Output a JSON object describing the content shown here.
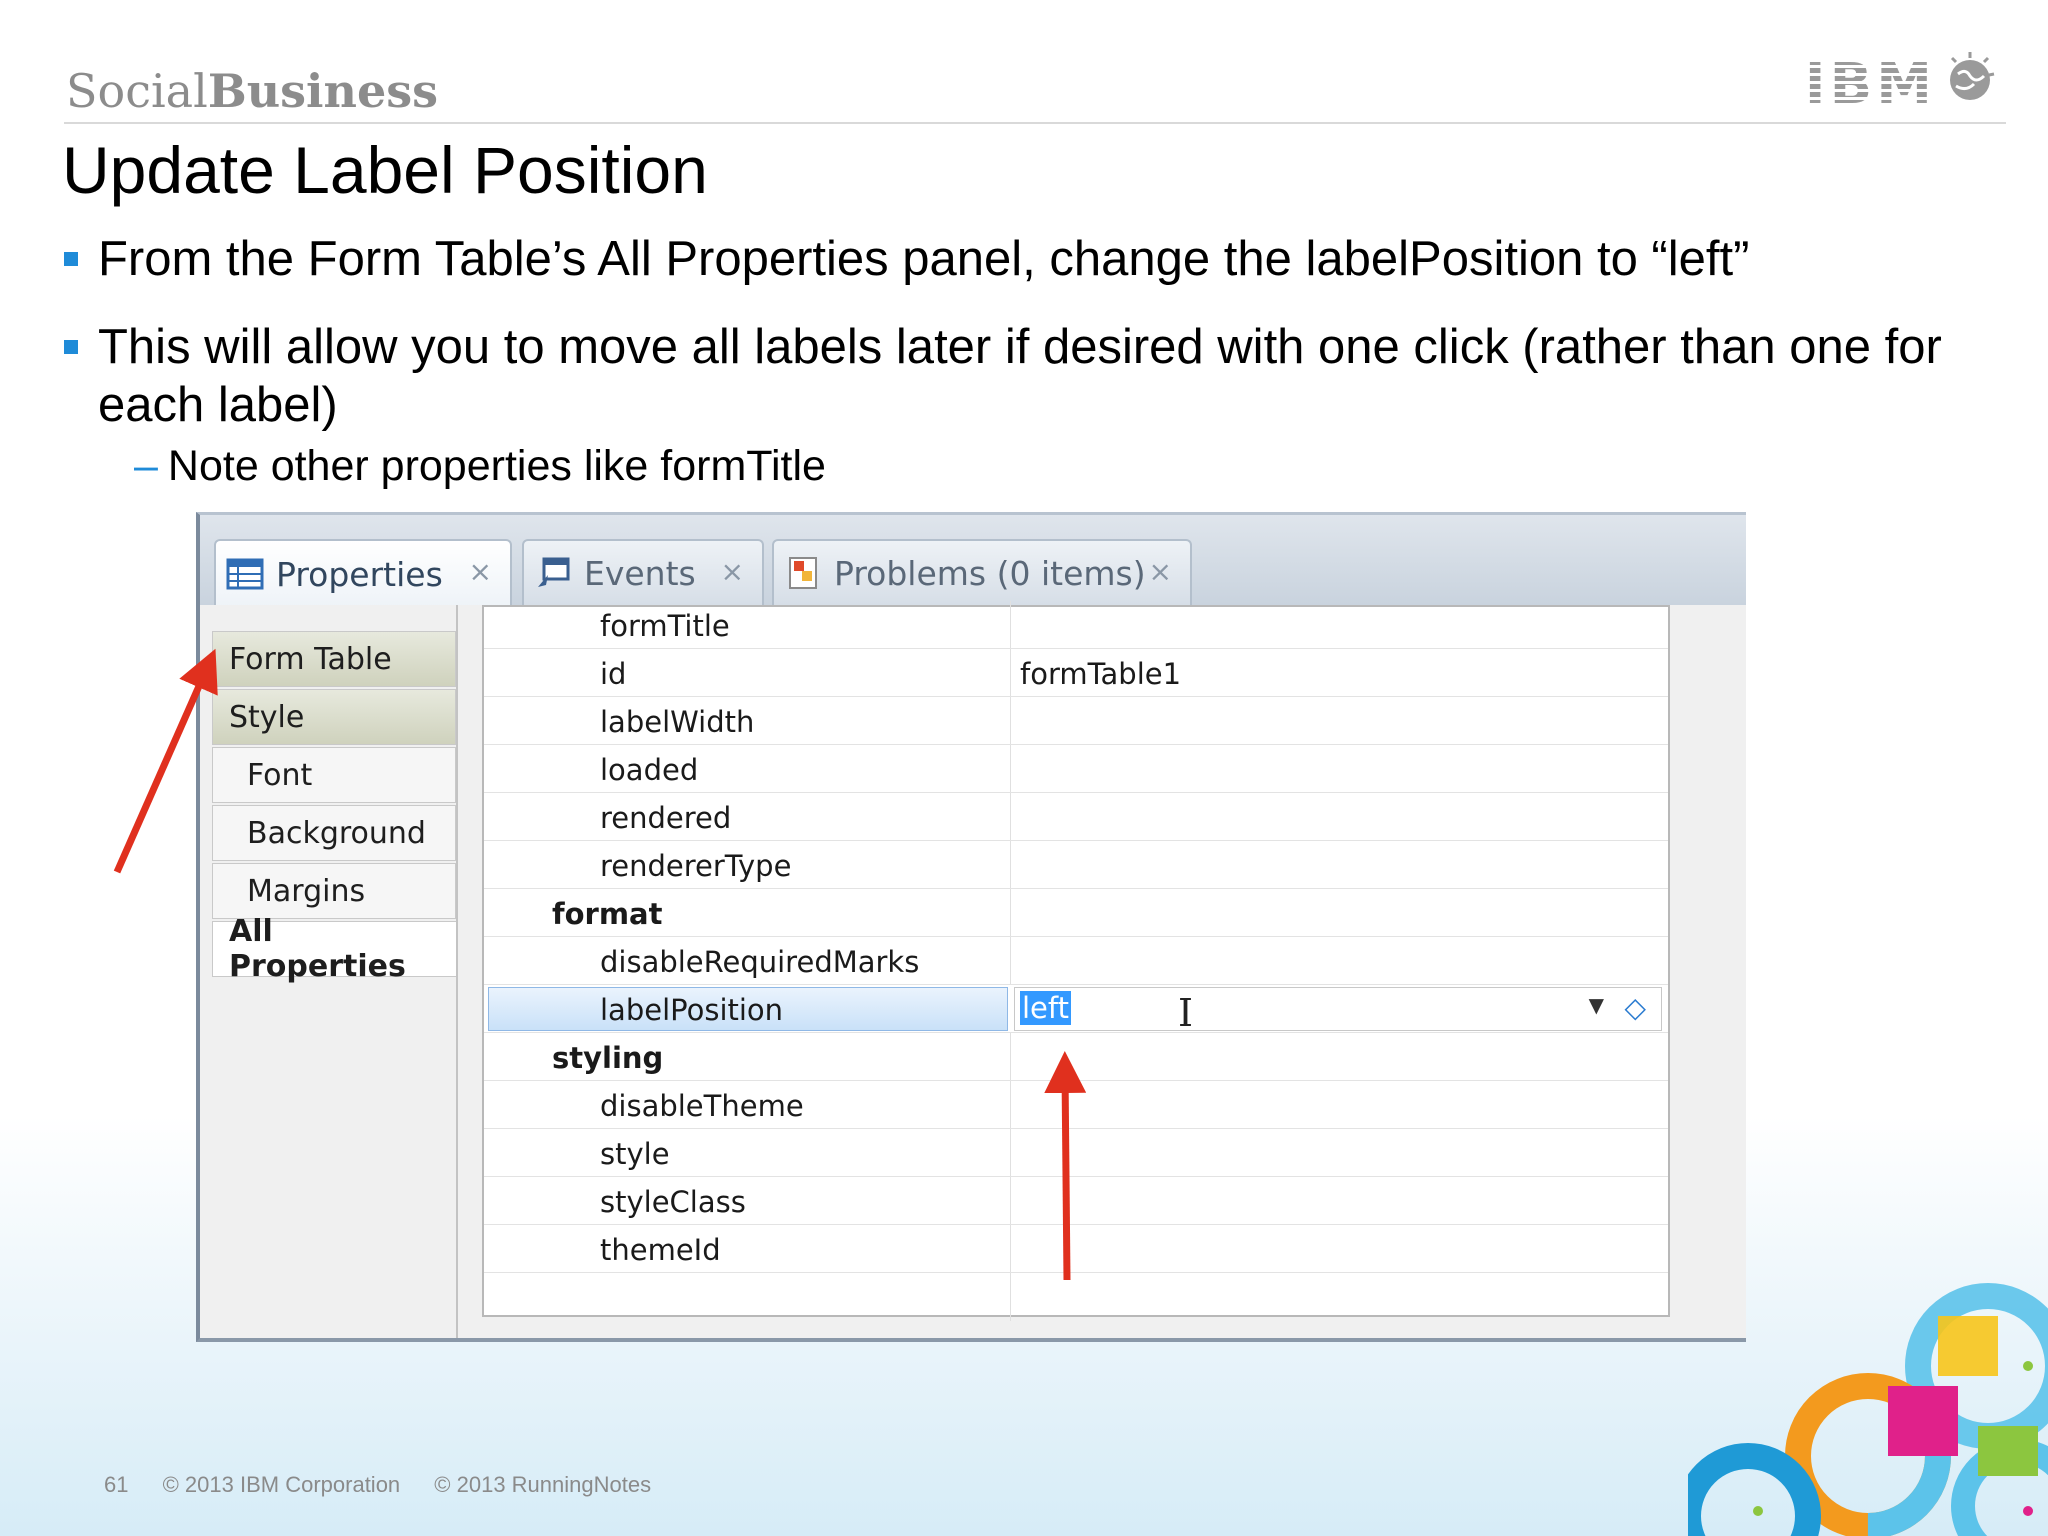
{
  "header": {
    "brand_part1": "Social",
    "brand_part2": "Business",
    "logo_text": "IBM",
    "logo_icon": "globe-icon"
  },
  "slide": {
    "title": "Update Label Position",
    "bullets": [
      "From the Form Table’s All Properties panel, change the labelPosition to “left”",
      "This will allow you to move all labels later if desired with one click (rather than one for each label)"
    ],
    "sub_bullet_dash": "–",
    "sub_bullet": "Note other properties like formTitle"
  },
  "tabs": [
    {
      "label": "Properties",
      "icon": "properties-table-icon",
      "close": "×",
      "active": true
    },
    {
      "label": "Events",
      "icon": "events-icon",
      "close": "×",
      "active": false
    },
    {
      "label": "Problems (0 items)",
      "icon": "problems-icon",
      "close": "×",
      "active": false
    }
  ],
  "sidebar": {
    "items": [
      "Form Table",
      "Style",
      "Font",
      "Background",
      "Margins",
      "All Properties"
    ]
  },
  "grid": {
    "rows": [
      {
        "name": "formTitle",
        "value": ""
      },
      {
        "name": "id",
        "value": "formTable1"
      },
      {
        "name": "labelWidth",
        "value": ""
      },
      {
        "name": "loaded",
        "value": ""
      },
      {
        "name": "rendered",
        "value": ""
      },
      {
        "name": "rendererType",
        "value": ""
      },
      {
        "category": "format"
      },
      {
        "name": "disableRequiredMarks",
        "value": ""
      },
      {
        "name": "labelPosition",
        "value": "left",
        "editing": true
      },
      {
        "category": "styling"
      },
      {
        "name": "disableTheme",
        "value": ""
      },
      {
        "name": "style",
        "value": ""
      },
      {
        "name": "styleClass",
        "value": ""
      },
      {
        "name": "themeId",
        "value": ""
      }
    ],
    "dropdown_icon": "dropdown-arrow-icon",
    "reset_icon": "reset-diamond-icon"
  },
  "footer": {
    "page_number": "61",
    "copyright1": "© 2013 IBM Corporation",
    "copyright2": "© 2013 RunningNotes"
  },
  "colors": {
    "bullet_accent": "#1f8bd8",
    "annotation_arrow": "#e0301e",
    "selection": "#3399ff"
  }
}
